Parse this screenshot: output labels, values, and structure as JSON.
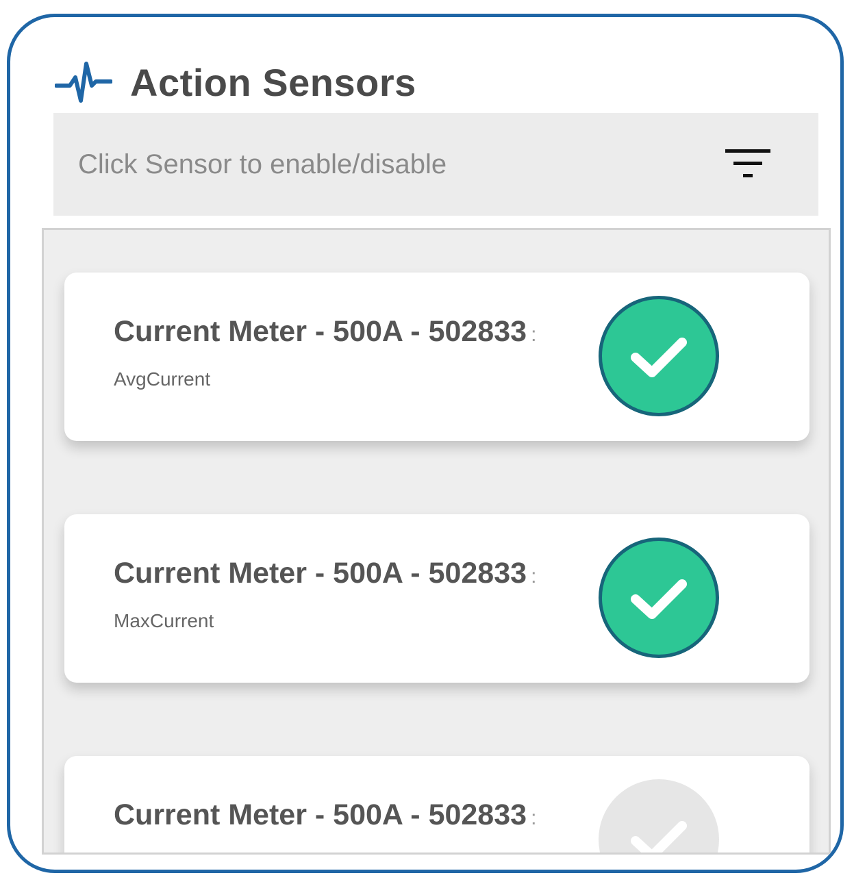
{
  "header": {
    "icon": "pulse-icon",
    "title": "Action Sensors"
  },
  "filter_bar": {
    "hint": "Click Sensor to enable/disable",
    "icon": "filter-icon"
  },
  "sensors": [
    {
      "name": "Current Meter - 500A - 502833",
      "separator": ":",
      "type": "AvgCurrent",
      "enabled": true
    },
    {
      "name": "Current Meter - 500A - 502833",
      "separator": ":",
      "type": "MaxCurrent",
      "enabled": true
    },
    {
      "name": "Current Meter - 500A - 502833",
      "separator": ":",
      "type": "",
      "enabled": false
    }
  ],
  "colors": {
    "frame_border": "#1f66a6",
    "enabled_fill": "#2dc795",
    "enabled_ring": "#17657a",
    "disabled_fill": "#e6e6e6",
    "accent_icon": "#1f66a6"
  }
}
